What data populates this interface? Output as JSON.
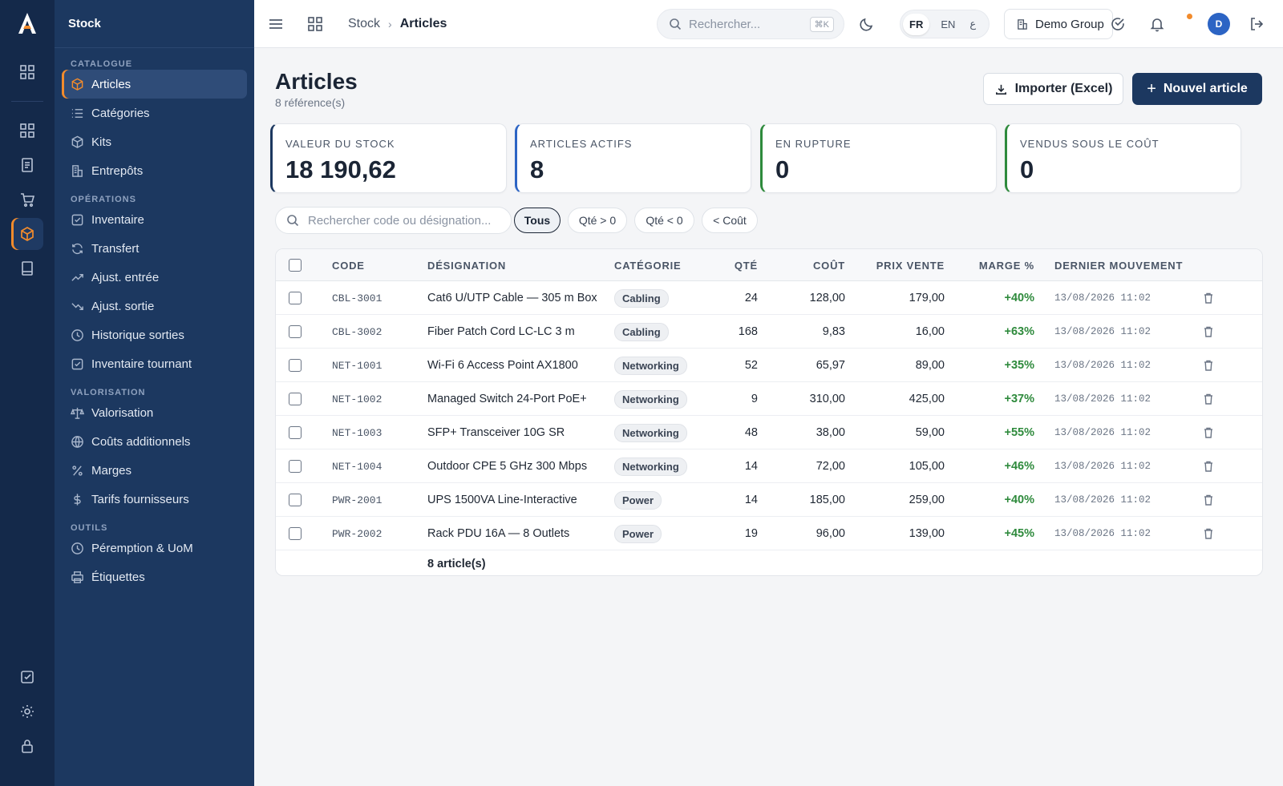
{
  "app": {
    "section_title": "Stock",
    "brand_color": "#f28b2c",
    "sidebar_bg": "#1c3860"
  },
  "sidebar": {
    "groups": [
      {
        "title": "CATALOGUE",
        "items": [
          {
            "label": "Articles",
            "icon": "box-icon",
            "active": true
          },
          {
            "label": "Catégories",
            "icon": "list-icon"
          },
          {
            "label": "Kits",
            "icon": "package-icon"
          },
          {
            "label": "Entrepôts",
            "icon": "building-icon"
          }
        ]
      },
      {
        "title": "OPÉRATIONS",
        "items": [
          {
            "label": "Inventaire",
            "icon": "checkbox-icon"
          },
          {
            "label": "Transfert",
            "icon": "refresh-icon"
          },
          {
            "label": "Ajust. entrée",
            "icon": "trending-up-icon"
          },
          {
            "label": "Ajust. sortie",
            "icon": "trending-down-icon"
          },
          {
            "label": "Historique sorties",
            "icon": "clock-icon"
          },
          {
            "label": "Inventaire tournant",
            "icon": "checkbox-icon"
          }
        ]
      },
      {
        "title": "VALORISATION",
        "items": [
          {
            "label": "Valorisation",
            "icon": "scale-icon"
          },
          {
            "label": "Coûts additionnels",
            "icon": "globe-icon"
          },
          {
            "label": "Marges",
            "icon": "percent-icon"
          },
          {
            "label": "Tarifs fournisseurs",
            "icon": "dollar-icon"
          }
        ]
      },
      {
        "title": "OUTILS",
        "items": [
          {
            "label": "Péremption & UoM",
            "icon": "clock-icon"
          },
          {
            "label": "Étiquettes",
            "icon": "printer-icon"
          }
        ]
      }
    ]
  },
  "header": {
    "breadcrumb_root": "Stock",
    "breadcrumb_current": "Articles",
    "search_placeholder": "Rechercher...",
    "search_shortcut": "⌘K",
    "lang_fr": "FR",
    "lang_en": "EN",
    "lang_more": "ع",
    "org_name": "Demo Group",
    "avatar_initial": "D"
  },
  "page": {
    "title": "Articles",
    "subtitle": "8 référence(s)",
    "import_label": "Importer (Excel)",
    "new_label": "Nouvel article"
  },
  "kpis": [
    {
      "label": "VALEUR DU STOCK",
      "value": "18 190,62",
      "accent": "#1c3860"
    },
    {
      "label": "ARTICLES ACTIFS",
      "value": "8",
      "accent": "#2c64c4"
    },
    {
      "label": "EN RUPTURE",
      "value": "0",
      "accent": "#2e8a3c"
    },
    {
      "label": "VENDUS SOUS LE COÛT",
      "value": "0",
      "accent": "#2e8a3c"
    }
  ],
  "filters": {
    "search_placeholder": "Rechercher code ou désignation...",
    "chips": [
      "Tous",
      "Qté > 0",
      "Qté < 0",
      "< Coût"
    ]
  },
  "table": {
    "columns": [
      "CODE",
      "DÉSIGNATION",
      "CATÉGORIE",
      "QTÉ",
      "COÛT",
      "PRIX VENTE",
      "MARGE %",
      "DERNIER MOUVEMENT"
    ],
    "rows": [
      [
        "CBL-3001",
        "Cat6 U/UTP Cable — 305 m Box",
        "Cabling",
        "24",
        "128,00",
        "179,00",
        "+40%",
        "13/08/2026 11:02"
      ],
      [
        "CBL-3002",
        "Fiber Patch Cord LC-LC 3 m",
        "Cabling",
        "168",
        "9,83",
        "16,00",
        "+63%",
        "13/08/2026 11:02"
      ],
      [
        "NET-1001",
        "Wi-Fi 6 Access Point AX1800",
        "Networking",
        "52",
        "65,97",
        "89,00",
        "+35%",
        "13/08/2026 11:02"
      ],
      [
        "NET-1002",
        "Managed Switch 24-Port PoE+",
        "Networking",
        "9",
        "310,00",
        "425,00",
        "+37%",
        "13/08/2026 11:02"
      ],
      [
        "NET-1003",
        "SFP+ Transceiver 10G SR",
        "Networking",
        "48",
        "38,00",
        "59,00",
        "+55%",
        "13/08/2026 11:02"
      ],
      [
        "NET-1004",
        "Outdoor CPE 5 GHz 300 Mbps",
        "Networking",
        "14",
        "72,00",
        "105,00",
        "+46%",
        "13/08/2026 11:02"
      ],
      [
        "PWR-2001",
        "UPS 1500VA Line-Interactive",
        "Power",
        "14",
        "185,00",
        "259,00",
        "+40%",
        "13/08/2026 11:02"
      ],
      [
        "PWR-2002",
        "Rack PDU 16A — 8 Outlets",
        "Power",
        "19",
        "96,00",
        "139,00",
        "+45%",
        "13/08/2026 11:02"
      ]
    ],
    "footer": "8 article(s)"
  }
}
